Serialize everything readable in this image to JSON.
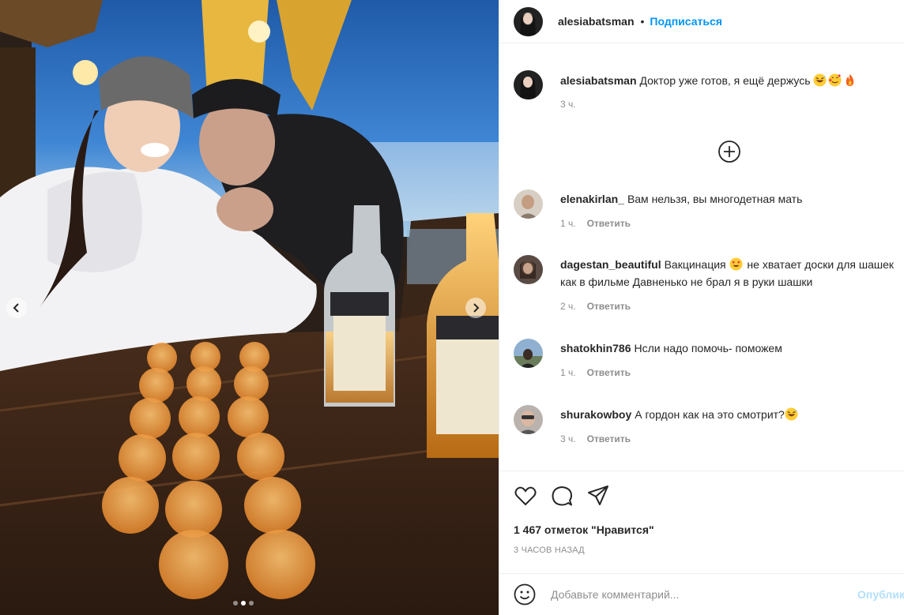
{
  "post": {
    "author": "alesiabatsman",
    "follow_label": "Подписаться",
    "separator": "•",
    "caption": {
      "user": "alesiabatsman",
      "text": "Доктор уже готов, я ещё держусь",
      "emojis": [
        "grinning-sweat-emoji",
        "smiling-hearts-emoji",
        "fire-emoji"
      ],
      "time": "3 ч."
    },
    "likes": "1 467 отметок \"Нравится\"",
    "date": "3 ЧАСОВ НАЗАД"
  },
  "comments": [
    {
      "user": "elenakirlan_",
      "text": "Вам нельзя, вы многодетная мать",
      "time": "1 ч.",
      "reply": "Ответить"
    },
    {
      "user": "dagestan_beautiful",
      "text_before": "Вакцинация",
      "emoji": "heart-eyes-emoji",
      "text_after": "не хватает доски для шашек как в фильме Давненько не брал я в руки шашки",
      "time": "2 ч.",
      "reply": "Ответить"
    },
    {
      "user": "shatokhin786",
      "text": "Нсли надо помочь- поможем",
      "time": "1 ч.",
      "reply": "Ответить"
    },
    {
      "user": "shurakowboy",
      "text": "А гордон как на это смотрит?",
      "emoji": "grinning-sweat-emoji",
      "time": "3 ч.",
      "reply": "Ответить"
    }
  ],
  "add_comment": {
    "placeholder": "Добавьте комментарий...",
    "post_label": "Опубликовать"
  },
  "carousel": {
    "slide_count": 3,
    "active_index": 1
  },
  "icons": [
    "like-icon",
    "comment-icon",
    "share-icon",
    "load-more-icon",
    "emoji-icon",
    "chevron-left-icon",
    "chevron-right-icon"
  ],
  "colors": {
    "link": "#0095f6",
    "post_disabled": "#b2dffc",
    "muted": "#8e8e8e",
    "text": "#262626",
    "border": "#efefef"
  }
}
